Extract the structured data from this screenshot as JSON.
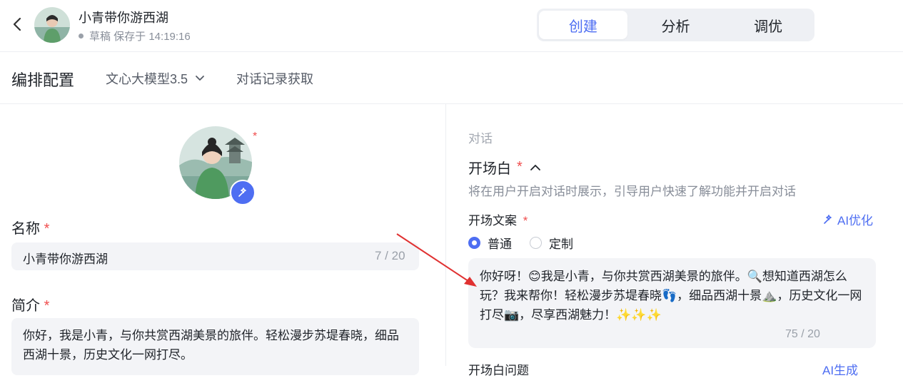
{
  "header": {
    "app_title": "小青带你游西湖",
    "status": "草稿 保存于 14:19:16",
    "tabs": [
      {
        "label": "创建",
        "active": true
      },
      {
        "label": "分析",
        "active": false
      },
      {
        "label": "调优",
        "active": false
      }
    ]
  },
  "subbar": {
    "title": "编排配置",
    "model": "文心大模型3.5",
    "history": "对话记录获取"
  },
  "left": {
    "required_mark": "*",
    "name_label": "名称",
    "name_value": "小青带你游西湖",
    "name_count": "7 / 20",
    "intro_label": "简介",
    "intro_value": "你好，我是小青，与你共赏西湖美景的旅伴。轻松漫步苏堤春晓，细品西湖十景，历史文化一网打尽。"
  },
  "right": {
    "section": "对话",
    "opening_title": "开场白",
    "opening_desc": "将在用户开启对话时展示，引导用户快速了解功能并开启对话",
    "copy_label": "开场文案",
    "ai_optimize": "AI优化",
    "radio_options": [
      {
        "label": "普通",
        "selected": true
      },
      {
        "label": "定制",
        "selected": false
      }
    ],
    "message": "你好呀！😊我是小青，与你共赏西湖美景的旅伴。🔍想知道西湖怎么玩？我来帮你！轻松漫步苏堤春晓👣，细品西湖十景⛰️，历史文化一网打尽📷，尽享西湖魅力！✨✨✨",
    "message_count": "75 / 20",
    "next_label": "开场白问题",
    "next_ai": "AI生成"
  },
  "colors": {
    "accent": "#4e6ef2",
    "required": "#f04e4e",
    "annotation_arrow": "#e03131"
  }
}
